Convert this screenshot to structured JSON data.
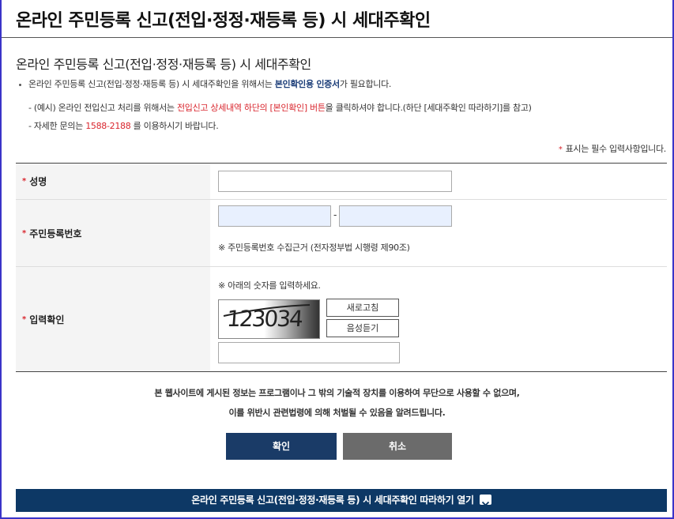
{
  "header": {
    "title": "온라인 주민등록 신고(전입·정정·재등록 등) 시 세대주확인"
  },
  "section": {
    "title": "온라인 주민등록 신고(전입·정정·재등록 등) 시 세대주확인"
  },
  "info": {
    "line1_prefix": "온라인 주민등록 신고(전입·정정·재등록 등) 시 세대주확인을 위해서는 ",
    "line1_highlight": "본인확인용 인증서",
    "line1_suffix": "가 필요합니다.",
    "line2_prefix": "- (예시) 온라인 전입신고 처리를 위해서는 ",
    "line2_red": "전입신고 상세내역 하단의 [본인확인] 버튼",
    "line2_suffix": "을 클릭하셔야 합니다.(하단 [세대주확인 따라하기]를 참고)",
    "line3_prefix": "- 자세한 문의는 ",
    "line3_phone": "1588-2188",
    "line3_suffix": " 를 이용하시기 바랍니다."
  },
  "required_note": {
    "star": "*",
    "text": "표시는 필수 입력사항입니다."
  },
  "form": {
    "name_label": "성명",
    "rrn_label": "주민등록번호",
    "rrn_separator": "-",
    "rrn_note": "※ 주민등록번호 수집근거 (전자정부법 시행령 제90조)",
    "captcha_label": "입력확인",
    "captcha_note": "※ 아래의 숫자를 입력하세요.",
    "captcha_code": "123034",
    "refresh_button": "새로고침",
    "audio_button": "음성듣기",
    "required_mark": "*"
  },
  "warning": {
    "line1": "본 웹사이트에 게시된 정보는 프로그램이나 그 밖의 기술적 장치를 이용하여 무단으로 사용할 수 없으며,",
    "line2": "이를 위반시 관련법령에 의해 처벌될 수 있음을 알려드립니다."
  },
  "buttons": {
    "confirm": "확인",
    "cancel": "취소"
  },
  "bottom_bar": {
    "label": "온라인 주민등록 신고(전입·정정·재등록 등) 시 세대주확인 따라하기 열기",
    "icon": "chevron-down-icon"
  },
  "colors": {
    "frame": "#3a34c8",
    "navy": "#1a3b67",
    "red": "#d9262e",
    "bar": "#0d3865"
  }
}
